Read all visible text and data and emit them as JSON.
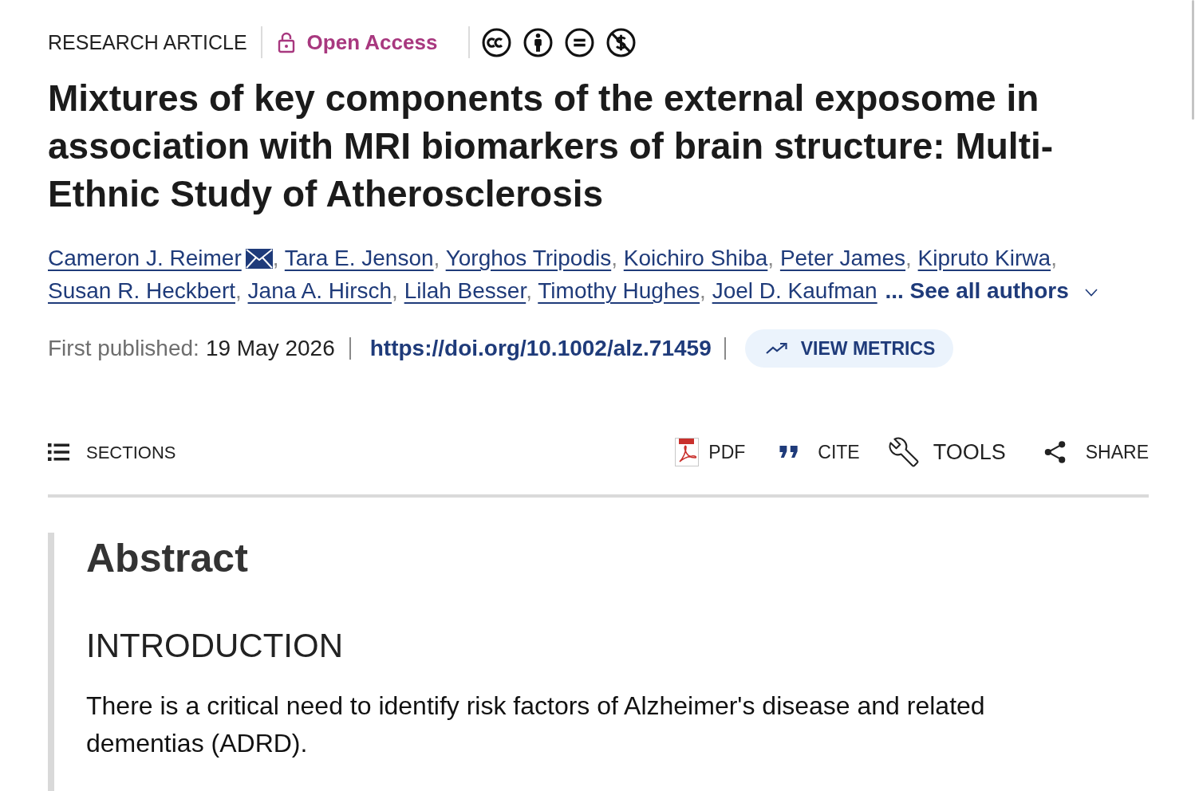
{
  "article_header": {
    "article_type": "RESEARCH ARTICLE",
    "access": "Open Access"
  },
  "title": "Mixtures of key components of the external exposome in association with MRI biomarkers of brain structure: Multi-Ethnic Study of Atherosclerosis",
  "authors": [
    {
      "name": "Cameron J. Reimer",
      "corresponding": true,
      "separator": ","
    },
    {
      "name": "Tara E. Jenson",
      "corresponding": false,
      "separator": ","
    },
    {
      "name": "Yorghos Tripodis",
      "corresponding": false,
      "separator": ","
    },
    {
      "name": "Koichiro Shiba",
      "corresponding": false,
      "separator": ","
    },
    {
      "name": "Peter James",
      "corresponding": false,
      "separator": ","
    },
    {
      "name": "Kipruto Kirwa",
      "corresponding": false,
      "separator": ","
    },
    {
      "name": "Susan R. Heckbert",
      "corresponding": false,
      "separator": ","
    },
    {
      "name": "Jana A. Hirsch",
      "corresponding": false,
      "separator": ","
    },
    {
      "name": "Lilah Besser",
      "corresponding": false,
      "separator": ","
    },
    {
      "name": "Timothy Hughes",
      "corresponding": false,
      "separator": ","
    },
    {
      "name": "Joel D. Kaufman",
      "corresponding": false
    }
  ],
  "see_all_authors": "... See all authors",
  "publication": {
    "label": "First published:",
    "date": "19 May 2026",
    "doi": "https://doi.org/10.1002/alz.71459",
    "metrics_button": "VIEW METRICS"
  },
  "toolbar": {
    "sections": "SECTIONS",
    "actions": [
      {
        "kind": "pdf",
        "label": "PDF"
      },
      {
        "kind": "cite",
        "label": "CITE"
      },
      {
        "kind": "tools",
        "label": "TOOLS"
      },
      {
        "kind": "share",
        "label": "SHARE"
      }
    ]
  },
  "abstract": {
    "heading": "Abstract",
    "sections": [
      {
        "heading": "INTRODUCTION",
        "text": "There is a critical need to identify risk factors of Alzheimer's disease and related dementias (ADRD)."
      }
    ]
  }
}
